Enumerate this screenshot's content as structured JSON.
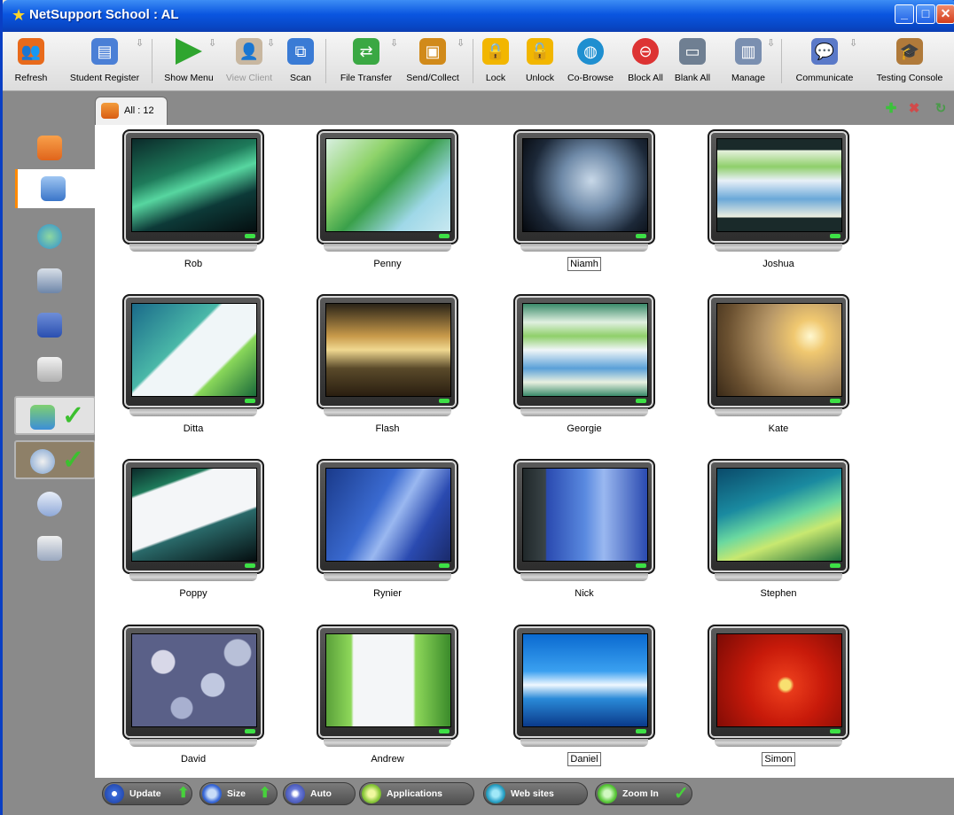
{
  "window": {
    "title": "NetSupport School : AL"
  },
  "toolbar": {
    "items": [
      {
        "label": "Refresh",
        "icon": "refresh-users-icon",
        "color": "#e86a1b"
      },
      {
        "label": "Student Register",
        "icon": "student-register-icon",
        "color": "#4a7fd6"
      },
      {
        "label": "Show Menu",
        "icon": "show-menu-play-icon",
        "color": "#2fa52f"
      },
      {
        "label": "View Client",
        "icon": "view-client-icon",
        "color": "#c8b7a0",
        "disabled": true
      },
      {
        "label": "Scan",
        "icon": "scan-icon",
        "color": "#3a7bd5"
      },
      {
        "label": "File Transfer",
        "icon": "file-transfer-icon",
        "color": "#3aa843"
      },
      {
        "label": "Send/Collect",
        "icon": "send-collect-icon",
        "color": "#d18a1a"
      },
      {
        "label": "Lock",
        "icon": "lock-icon",
        "color": "#f2b600"
      },
      {
        "label": "Unlock",
        "icon": "unlock-icon",
        "color": "#f2b600"
      },
      {
        "label": "Co-Browse",
        "icon": "co-browse-globe-icon",
        "color": "#1f8fd0"
      },
      {
        "label": "Block All",
        "icon": "block-all-icon",
        "color": "#d33"
      },
      {
        "label": "Blank All",
        "icon": "blank-all-monitor-icon",
        "color": "#6f7f92"
      },
      {
        "label": "Manage",
        "icon": "manage-icon",
        "color": "#7a8fb0"
      },
      {
        "label": "Communicate",
        "icon": "communicate-icon",
        "color": "#5a79c8"
      },
      {
        "label": "Testing Console",
        "icon": "testing-console-icon",
        "color": "#b07a3a"
      }
    ]
  },
  "tabs": [
    {
      "label": "All : 12"
    }
  ],
  "sidebar": {
    "items": [
      {
        "icon": "students-icon"
      },
      {
        "icon": "network-computers-icon"
      },
      {
        "icon": "web-search-icon"
      },
      {
        "icon": "document-zoom-icon"
      },
      {
        "icon": "checklist-icon"
      },
      {
        "icon": "box-icon"
      },
      {
        "icon": "students-check-icon"
      },
      {
        "icon": "disc-check-icon"
      },
      {
        "icon": "eraser-icon"
      },
      {
        "icon": "pen-icon"
      }
    ]
  },
  "clients": [
    {
      "name": "Rob",
      "wallpaper": "aurora",
      "boxed": false
    },
    {
      "name": "Penny",
      "wallpaper": "palm",
      "boxed": false
    },
    {
      "name": "Niamh",
      "wallpaper": "dark-blue",
      "boxed": true
    },
    {
      "name": "Joshua",
      "wallpaper": "website",
      "boxed": false
    },
    {
      "name": "Ditta",
      "wallpaper": "vista-browser",
      "boxed": false
    },
    {
      "name": "Flash",
      "wallpaper": "sunset-rocks",
      "boxed": false
    },
    {
      "name": "Georgie",
      "wallpaper": "website-green",
      "boxed": false
    },
    {
      "name": "Kate",
      "wallpaper": "sunrise-field",
      "boxed": false
    },
    {
      "name": "Poppy",
      "wallpaper": "aurora-google",
      "boxed": false
    },
    {
      "name": "Rynier",
      "wallpaper": "vista-blue",
      "boxed": false
    },
    {
      "name": "Nick",
      "wallpaper": "vista-blue-menu",
      "boxed": false
    },
    {
      "name": "Stephen",
      "wallpaper": "vista-green",
      "boxed": false
    },
    {
      "name": "David",
      "wallpaper": "pebbles",
      "boxed": false
    },
    {
      "name": "Andrew",
      "wallpaper": "green-google",
      "boxed": false
    },
    {
      "name": "Daniel",
      "wallpaper": "fish",
      "boxed": true
    },
    {
      "name": "Simon",
      "wallpaper": "red-flower",
      "boxed": true
    }
  ],
  "statusbar": {
    "update": "Update",
    "size": "Size",
    "auto": "Auto",
    "applications": "Applications",
    "websites": "Web sites",
    "zoom_in": "Zoom In"
  }
}
